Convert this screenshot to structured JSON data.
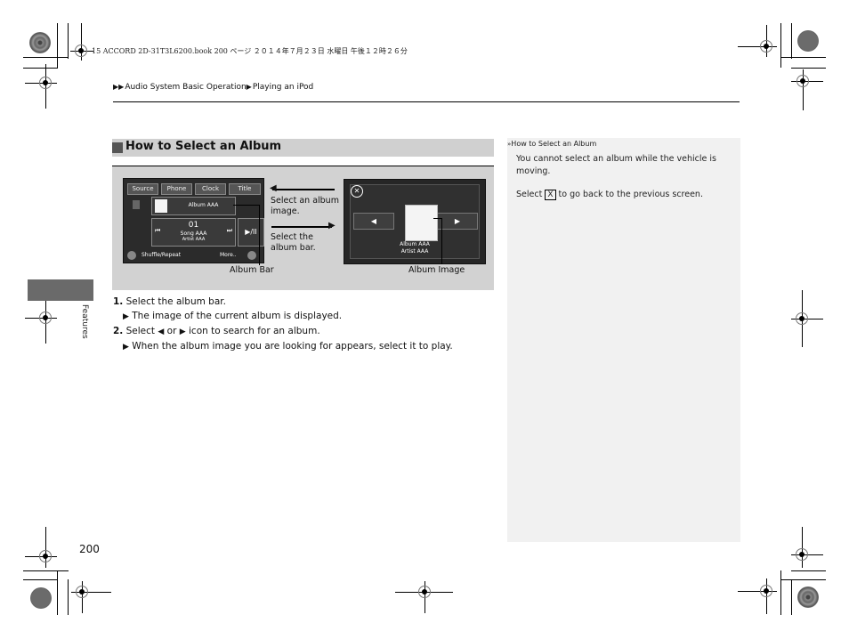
{
  "print_meta": "15 ACCORD 2D-31T3L6200.book  200 ページ  ２０１４年７月２３日  水曜日  午後１２時２６分",
  "breadcrumb": {
    "items": [
      "Audio System Basic Operation",
      "Playing an iPod"
    ]
  },
  "section": {
    "title": "How to Select an Album"
  },
  "figure": {
    "screen1": {
      "tabs": [
        "Source",
        "Phone",
        "Clock",
        "Title"
      ],
      "album": "Album AAA",
      "track_number": "01",
      "song": "Song AAA",
      "artist": "Artist AAA",
      "play_pause": "▶/II",
      "prev_icon": "⏮",
      "next_icon": "⏭",
      "shuffle": "Shuffle/Repeat",
      "more": "More.."
    },
    "screen2": {
      "close": "✕",
      "prev": "◀",
      "next": "▶",
      "album": "Album AAA",
      "artist": "Artist AAA"
    },
    "callouts": {
      "select_album_image": "Select an album image.",
      "select_album_bar": "Select the album bar.",
      "album_bar": "Album Bar",
      "album_image": "Album Image"
    }
  },
  "steps": [
    {
      "num": "1.",
      "text": "Select the album bar.",
      "result": "The image of the current album is displayed."
    },
    {
      "num": "2.",
      "text_before": "Select",
      "icon_left": "◀",
      "or": "or",
      "icon_right": "▶",
      "text_after": "icon to search for an album.",
      "result": "When the album image you are looking for appears, select it to play."
    }
  ],
  "sidebar": {
    "title": "How to Select an Album",
    "note1": "You cannot select an album while the vehicle is moving.",
    "note2_before": "Select",
    "note2_icon": "X",
    "note2_after": "to go back to the previous screen."
  },
  "side_tab": "Features",
  "page_number": "200"
}
